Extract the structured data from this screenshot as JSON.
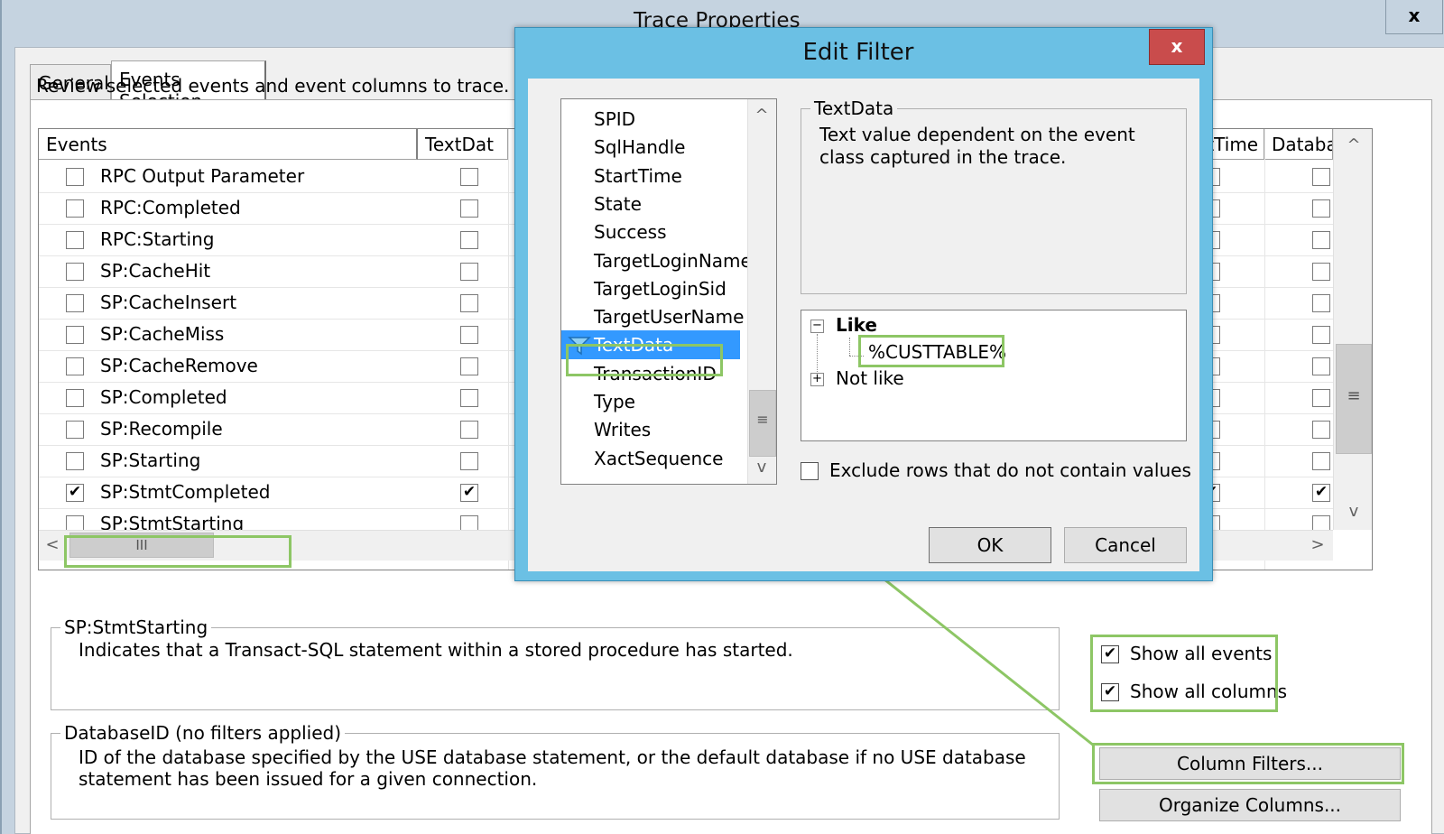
{
  "main_window": {
    "title": "Trace Properties",
    "close_glyph": "x"
  },
  "tabs": [
    {
      "label": "General"
    },
    {
      "label": "Events Selection"
    }
  ],
  "review_text": "Review selected events and event columns to trace. To se",
  "grid": {
    "headers": {
      "events": "Events",
      "textdata": "TextDat",
      "starttime": "tartTime",
      "database": "Databa"
    },
    "rows": [
      {
        "label": "RPC Output Parameter",
        "checked": false,
        "mark": ""
      },
      {
        "label": "RPC:Completed",
        "checked": false,
        "mark": ""
      },
      {
        "label": "RPC:Starting",
        "checked": false,
        "mark": ""
      },
      {
        "label": "SP:CacheHit",
        "checked": false,
        "mark": ""
      },
      {
        "label": "SP:CacheInsert",
        "checked": false,
        "mark": ""
      },
      {
        "label": "SP:CacheMiss",
        "checked": false,
        "mark": ""
      },
      {
        "label": "SP:CacheRemove",
        "checked": false,
        "mark": ""
      },
      {
        "label": "SP:Completed",
        "checked": false,
        "mark": ""
      },
      {
        "label": "SP:Recompile",
        "checked": false,
        "mark": ""
      },
      {
        "label": "SP:Starting",
        "checked": false,
        "mark": ""
      },
      {
        "label": "SP:StmtCompleted",
        "checked": true,
        "mark": "✔"
      },
      {
        "label": "SP:StmtStarting",
        "checked": false,
        "mark": ""
      }
    ],
    "scroll_grip": "≡",
    "hscroll_grip": "III",
    "arrow_up": "^",
    "arrow_down": "v",
    "arrow_left": "<",
    "arrow_right": ">"
  },
  "event_group": {
    "title": "SP:StmtStarting",
    "description": "Indicates that a Transact-SQL statement within a stored procedure has started."
  },
  "column_group": {
    "title": "DatabaseID (no filters applied)",
    "description": "ID of the database specified by the USE database statement, or the default database if no USE database statement has been issued for a given connection."
  },
  "options": {
    "show_all_events": "Show all events",
    "show_all_columns": "Show all columns",
    "check_mark": "✔"
  },
  "buttons": {
    "column_filters": "Column Filters...",
    "organize_columns": "Organize Columns..."
  },
  "dialog": {
    "title": "Edit Filter",
    "close_glyph": "x",
    "columns": [
      "SPID",
      "SqlHandle",
      "StartTime",
      "State",
      "Success",
      "TargetLoginName",
      "TargetLoginSid",
      "TargetUserName",
      "TextData",
      "TransactionID",
      "Type",
      "Writes",
      "XactSequence"
    ],
    "selected_column": "TextData",
    "desc_title": "TextData",
    "desc_text": "Text value dependent on the event class captured in the trace.",
    "tree": {
      "like_label": "Like",
      "like_value": "%CUSTTABLE%",
      "not_like_label": "Not like",
      "minus": "−",
      "plus": "+"
    },
    "exclude_label": "Exclude rows that do not contain values",
    "ok_label": "OK",
    "cancel_label": "Cancel",
    "list_grip": "≡",
    "arrow_up": "^",
    "arrow_down": "v"
  },
  "colors": {
    "highlight": "#8dc665",
    "dialog_frame": "#6bc0e4",
    "close_red": "#c94c4c",
    "selection_blue": "#3399ff"
  }
}
